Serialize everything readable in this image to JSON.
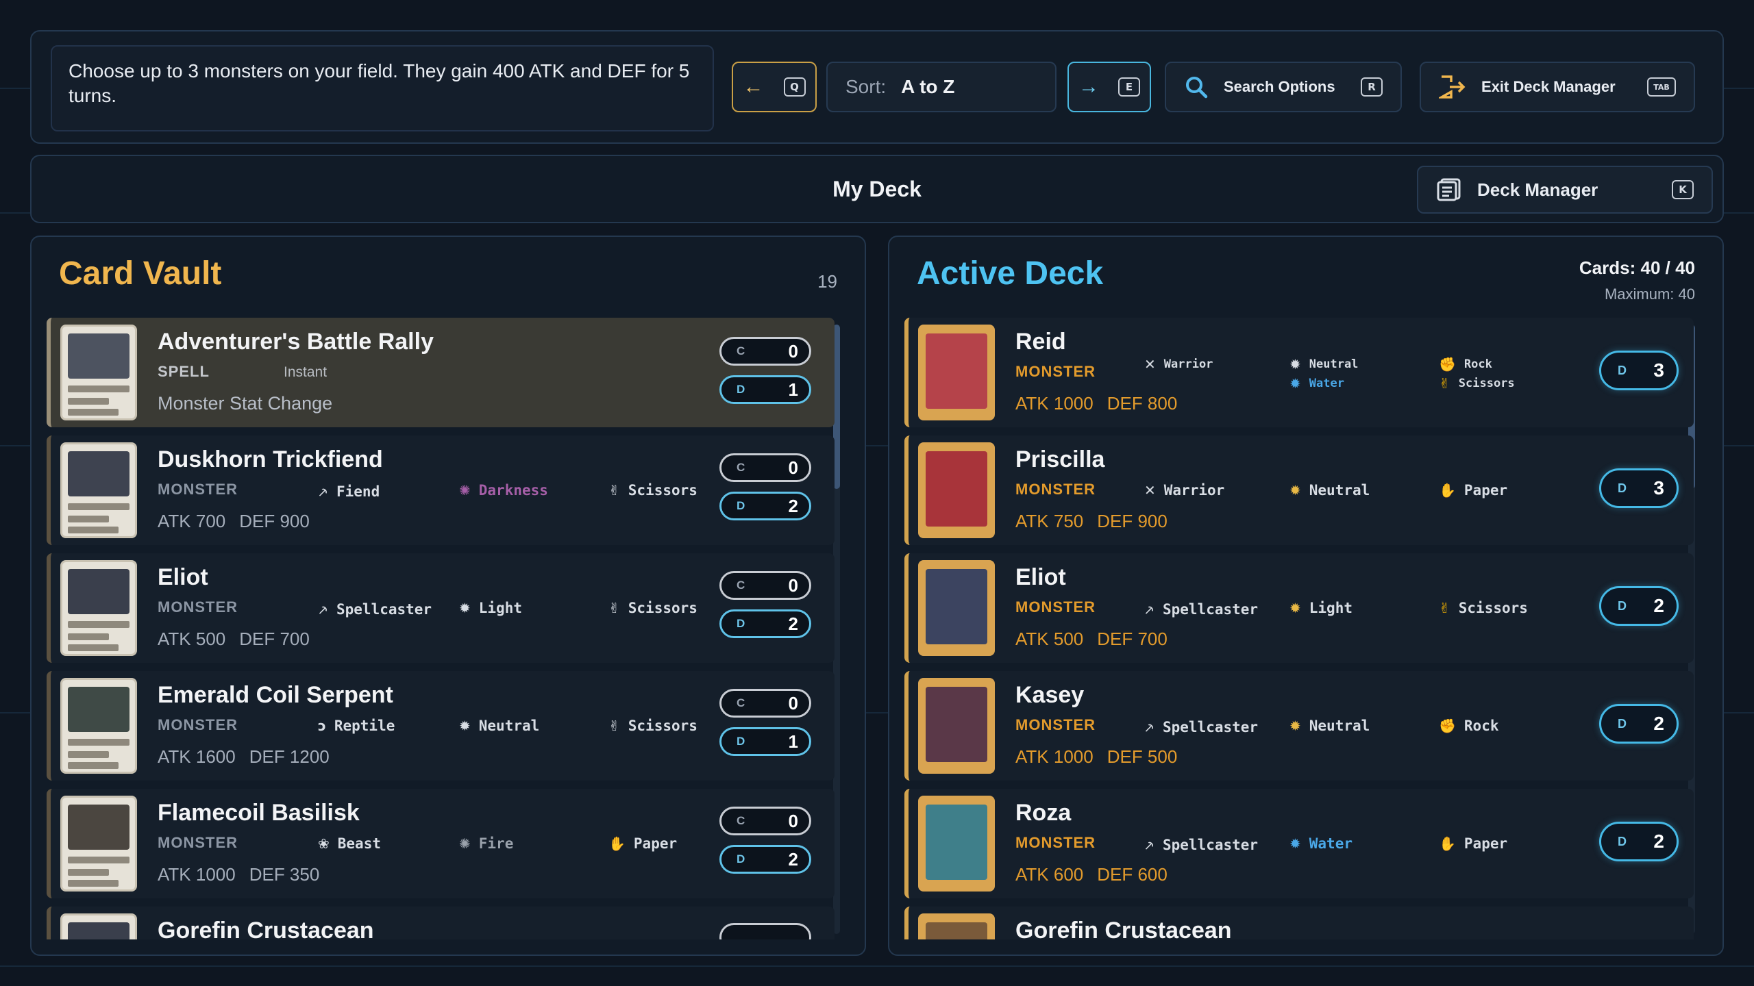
{
  "topbar": {
    "description": "Choose up to 3 monsters on your field. They gain 400 ATK and DEF for 5 turns.",
    "prev_key": "Q",
    "sort_label": "Sort:",
    "sort_value": "A to Z",
    "next_key": "E",
    "search_label": "Search Options",
    "search_key": "R",
    "exit_label": "Exit Deck Manager",
    "exit_key": "TAB"
  },
  "deckbar": {
    "title": "My Deck",
    "manager_label": "Deck Manager",
    "manager_key": "K"
  },
  "vault": {
    "title": "Card Vault",
    "count": "19",
    "cards": [
      {
        "name": "Adventurer's Battle Rally",
        "type": "SPELL",
        "spell_kind": "Instant",
        "effect": "Monster Stat Change",
        "c": "0",
        "d": "1"
      },
      {
        "name": "Duskhorn Trickfiend",
        "type": "MONSTER",
        "race": "Fiend",
        "attribute": "Darkness",
        "hand": "Scissors",
        "atk": "ATK 700",
        "def": "DEF 900",
        "c": "0",
        "d": "2"
      },
      {
        "name": "Eliot",
        "type": "MONSTER",
        "race": "Spellcaster",
        "attribute": "Light",
        "hand": "Scissors",
        "atk": "ATK 500",
        "def": "DEF 700",
        "c": "0",
        "d": "2"
      },
      {
        "name": "Emerald Coil Serpent",
        "type": "MONSTER",
        "race": "Reptile",
        "attribute": "Neutral",
        "hand": "Scissors",
        "atk": "ATK 1600",
        "def": "DEF 1200",
        "c": "0",
        "d": "1"
      },
      {
        "name": "Flamecoil Basilisk",
        "type": "MONSTER",
        "race": "Beast",
        "attribute": "Fire",
        "hand": "Paper",
        "atk": "ATK 1000",
        "def": "DEF 350",
        "c": "0",
        "d": "2"
      },
      {
        "name": "Gorefin Crustacean"
      }
    ]
  },
  "deck": {
    "title": "Active Deck",
    "cards_count": "Cards: 40 / 40",
    "maximum": "Maximum: 40",
    "cards": [
      {
        "name": "Reid",
        "type": "MONSTER",
        "race": "Warrior",
        "attribute": "Neutral",
        "attribute2": "Water",
        "hand": "Rock",
        "hand2": "Scissors",
        "atk": "ATK 1000",
        "def": "DEF 800",
        "d": "3"
      },
      {
        "name": "Priscilla",
        "type": "MONSTER",
        "race": "Warrior",
        "attribute": "Neutral",
        "hand": "Paper",
        "atk": "ATK 750",
        "def": "DEF 900",
        "d": "3"
      },
      {
        "name": "Eliot",
        "type": "MONSTER",
        "race": "Spellcaster",
        "attribute": "Light",
        "hand": "Scissors",
        "atk": "ATK 500",
        "def": "DEF 700",
        "d": "2"
      },
      {
        "name": "Kasey",
        "type": "MONSTER",
        "race": "Spellcaster",
        "attribute": "Neutral",
        "hand": "Rock",
        "atk": "ATK 1000",
        "def": "DEF 500",
        "d": "2"
      },
      {
        "name": "Roza",
        "type": "MONSTER",
        "race": "Spellcaster",
        "attribute": "Water",
        "hand": "Paper",
        "atk": "ATK 600",
        "def": "DEF 600",
        "d": "2"
      },
      {
        "name": "Gorefin Crustacean"
      }
    ]
  },
  "labels": {
    "c": "C",
    "d": "D"
  },
  "colors": {
    "vault_title": "#f0b64e",
    "deck_title": "#4ec3f2",
    "darkness": "#a65fa8",
    "water": "#4aa8e8",
    "monster_type": "#e39b2c"
  }
}
